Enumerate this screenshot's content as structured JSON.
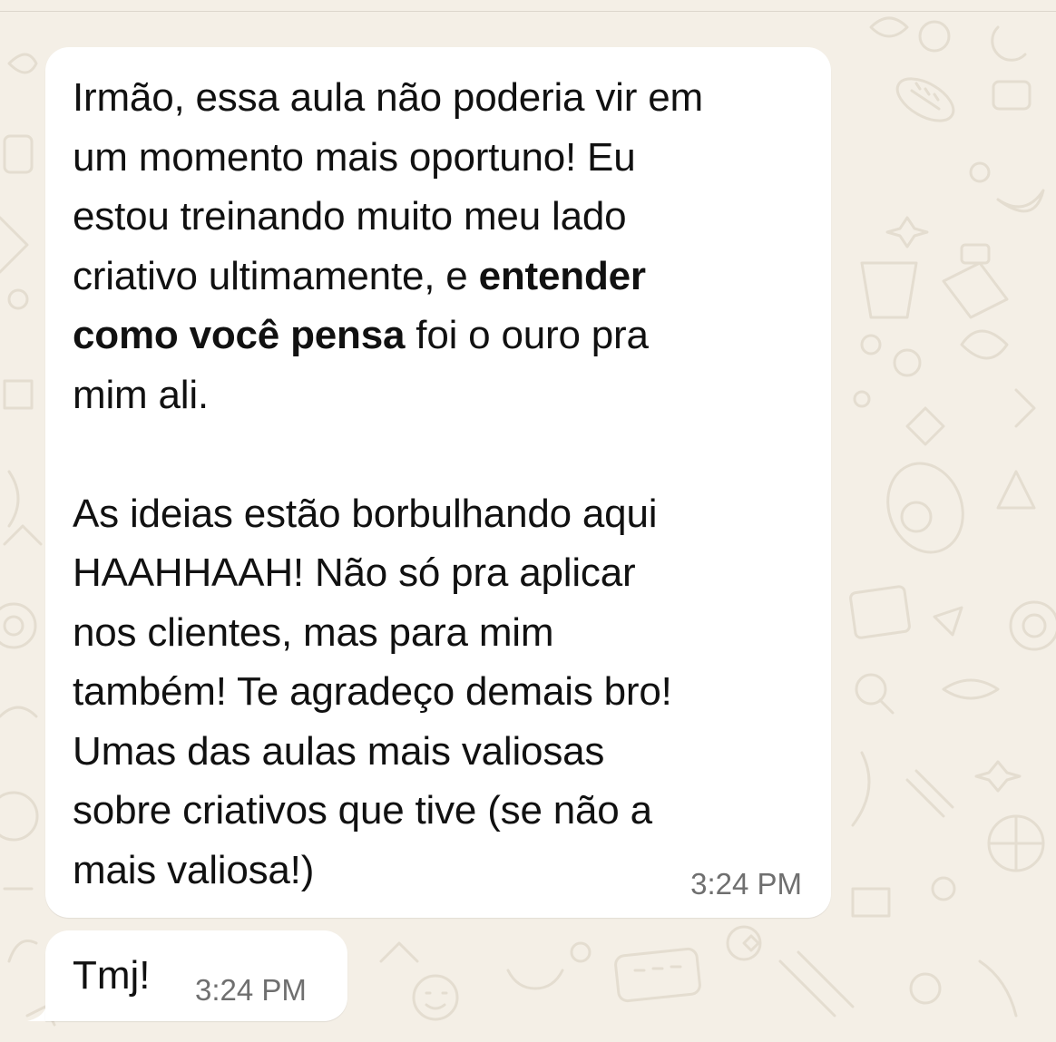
{
  "messages": [
    {
      "segments": [
        {
          "text": "Irmão, essa aula não poderia vir em\num momento mais oportuno! Eu\nestou treinando muito meu lado\ncriativo ultimamente, e ",
          "bold": false
        },
        {
          "text": "entender\ncomo você pensa",
          "bold": true
        },
        {
          "text": " foi o ouro pra\nmim ali.\n\nAs ideias estão borbulhando aqui\nHAAHHAAH! Não só pra aplicar\nnos clientes, mas para mim\ntambém! Te agradeço demais bro!\nUmas das aulas mais valiosas\nsobre criativos que tive (se não a\nmais valiosa!)",
          "bold": false
        }
      ],
      "time": "3:24 PM"
    },
    {
      "text": "Tmj!",
      "time": "3:24 PM"
    }
  ],
  "colors": {
    "background": "#f4efe6",
    "bubble": "#ffffff",
    "doodle": "#e6dfd2",
    "timestamp": "#6f6f6f"
  }
}
